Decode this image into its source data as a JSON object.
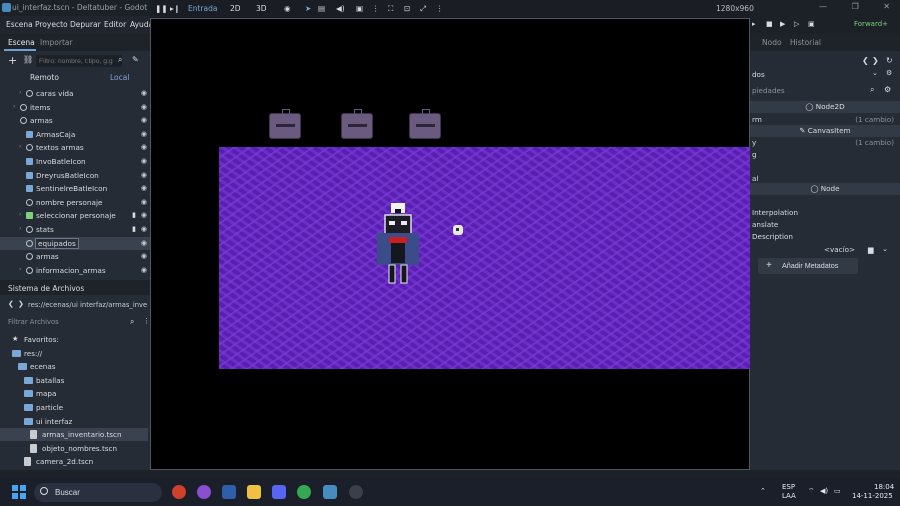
{
  "window": {
    "title": "ui_interfaz.tscn - Deltatuber - Godot Engine",
    "controls": [
      "—",
      "❐",
      "✕"
    ]
  },
  "menu": [
    "Escena",
    "Proyecto",
    "Depurar",
    "Editor",
    "Ayuda"
  ],
  "scene_dock": {
    "tabs": [
      "Escena",
      "Importar"
    ],
    "filter_placeholder": "Filtro: nombre, t:tipo, g:g",
    "remote": "Remoto",
    "local": "Local",
    "tree": [
      {
        "label": "caras vida",
        "icon": "circle",
        "indent": 2,
        "arrow": true
      },
      {
        "label": "items",
        "icon": "circle",
        "indent": 1,
        "arrow": true
      },
      {
        "label": "armas",
        "icon": "circle",
        "indent": 1,
        "arrow": false,
        "open": true
      },
      {
        "label": "ArmasCaja",
        "icon": "box",
        "indent": 2
      },
      {
        "label": "textos armas",
        "icon": "circle",
        "indent": 2,
        "arrow": true
      },
      {
        "label": "InvoBatleIcon",
        "icon": "box",
        "indent": 2
      },
      {
        "label": "DreyrusBatleIcon",
        "icon": "box",
        "indent": 2
      },
      {
        "label": "SentinelreBatleIcon",
        "icon": "box",
        "indent": 2
      },
      {
        "label": "nombre personaje",
        "icon": "circle",
        "indent": 2
      },
      {
        "label": "seleccionar personaje",
        "icon": "green",
        "indent": 2,
        "arrow": true,
        "script": true
      },
      {
        "label": "stats",
        "icon": "circle",
        "indent": 2,
        "arrow": true,
        "script": true
      },
      {
        "label": "equipados",
        "icon": "circle",
        "indent": 2,
        "selected": true
      },
      {
        "label": "armas",
        "icon": "circle",
        "indent": 2
      },
      {
        "label": "informacion_armas",
        "icon": "circle",
        "indent": 2,
        "arrow": true
      }
    ]
  },
  "filesystem": {
    "title": "Sistema de Archivos",
    "path": "res://ecenas/ui interfaz/armas_inve",
    "filter_placeholder": "Filtrar Archivos",
    "items": [
      {
        "label": "Favoritos:",
        "type": "star",
        "indent": 1
      },
      {
        "label": "res://",
        "type": "folder",
        "indent": 1
      },
      {
        "label": "ecenas",
        "type": "folder",
        "indent": 2
      },
      {
        "label": "batallas",
        "type": "folder",
        "indent": 3
      },
      {
        "label": "mapa",
        "type": "folder",
        "indent": 3
      },
      {
        "label": "particle",
        "type": "folder",
        "indent": 3
      },
      {
        "label": "ui interfaz",
        "type": "folder",
        "indent": 3
      },
      {
        "label": "armas_inventario.tscn",
        "type": "file",
        "indent": 4,
        "selected": true
      },
      {
        "label": "objeto_nombres.tscn",
        "type": "file",
        "indent": 4
      },
      {
        "label": "camera_2d.tscn",
        "type": "file",
        "indent": 3
      }
    ]
  },
  "viewport": {
    "entrada": "Entrada",
    "mode_2d": "2D",
    "mode_3d": "3D",
    "resolution": "1280x960"
  },
  "top_right": {
    "renderer": "Forward+"
  },
  "inspector": {
    "tabs": [
      "Nodo",
      "Historial"
    ],
    "header": "dos",
    "search": "piedades",
    "sec_node2d": "Node2D",
    "row_transform": {
      "k": "rm",
      "v": "(1 cambio)"
    },
    "sec_canvasitem": "CanvasItem",
    "row_visibility": {
      "k": "y",
      "v": "(1 cambio)"
    },
    "row_ordering": {
      "k": "g"
    },
    "row_texture": {
      "k": "al"
    },
    "sec_node": "Node",
    "row_process": {
      "k": "Interpolation"
    },
    "row_physics": {
      "k": "anslate"
    },
    "row_editor": {
      "k": "Description"
    },
    "vacio": "<vacío>",
    "add_metadata": "Añadir Metadatos"
  },
  "taskbar": {
    "search": "Buscar",
    "lang": "ESP",
    "layout": "LAA",
    "time": "18:04",
    "date": "14-11-2025"
  },
  "colors": {
    "accent": "#478cbf",
    "purple": "#5a1fb0",
    "renderer": "#7fd07a"
  }
}
